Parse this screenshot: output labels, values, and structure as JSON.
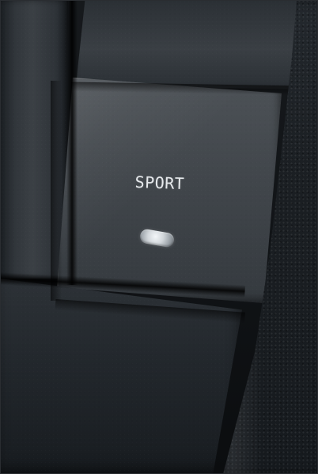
{
  "sport_button": {
    "label": "SPORT"
  },
  "icons": {
    "indicator": "sport-indicator-light"
  },
  "colors": {
    "panel_dark": "#1b1f23",
    "panel_mid": "#42474c",
    "label_text": "#e6e9ec",
    "indicator_light": "#d2d7db",
    "texture_dark": "#161a1e"
  }
}
